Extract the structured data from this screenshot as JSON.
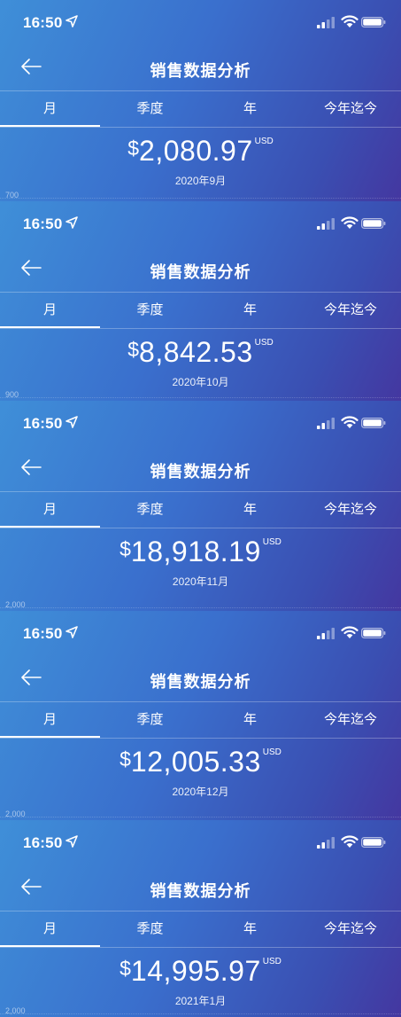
{
  "app": {
    "back_icon": "back-arrow-icon",
    "title": "销售数据分析"
  },
  "status_bar": {
    "time": "16:50"
  },
  "tabs": [
    "月",
    "季度",
    "年",
    "今年迄今"
  ],
  "currency_symbol": "$",
  "currency_unit": "USD",
  "screens": [
    {
      "amount": "2,080.97",
      "period": "2020年9月",
      "axis_label": "700",
      "active_tab": "月"
    },
    {
      "amount": "8,842.53",
      "period": "2020年10月",
      "axis_label": "900",
      "active_tab": "月"
    },
    {
      "amount": "18,918.19",
      "period": "2020年11月",
      "axis_label": "2,000",
      "active_tab": "月"
    },
    {
      "amount": "12,005.33",
      "period": "2020年12月",
      "axis_label": "2,000",
      "active_tab": "月"
    },
    {
      "amount": "14,995.97",
      "period": "2021年1月",
      "axis_label": "2,000",
      "active_tab": "月"
    }
  ]
}
